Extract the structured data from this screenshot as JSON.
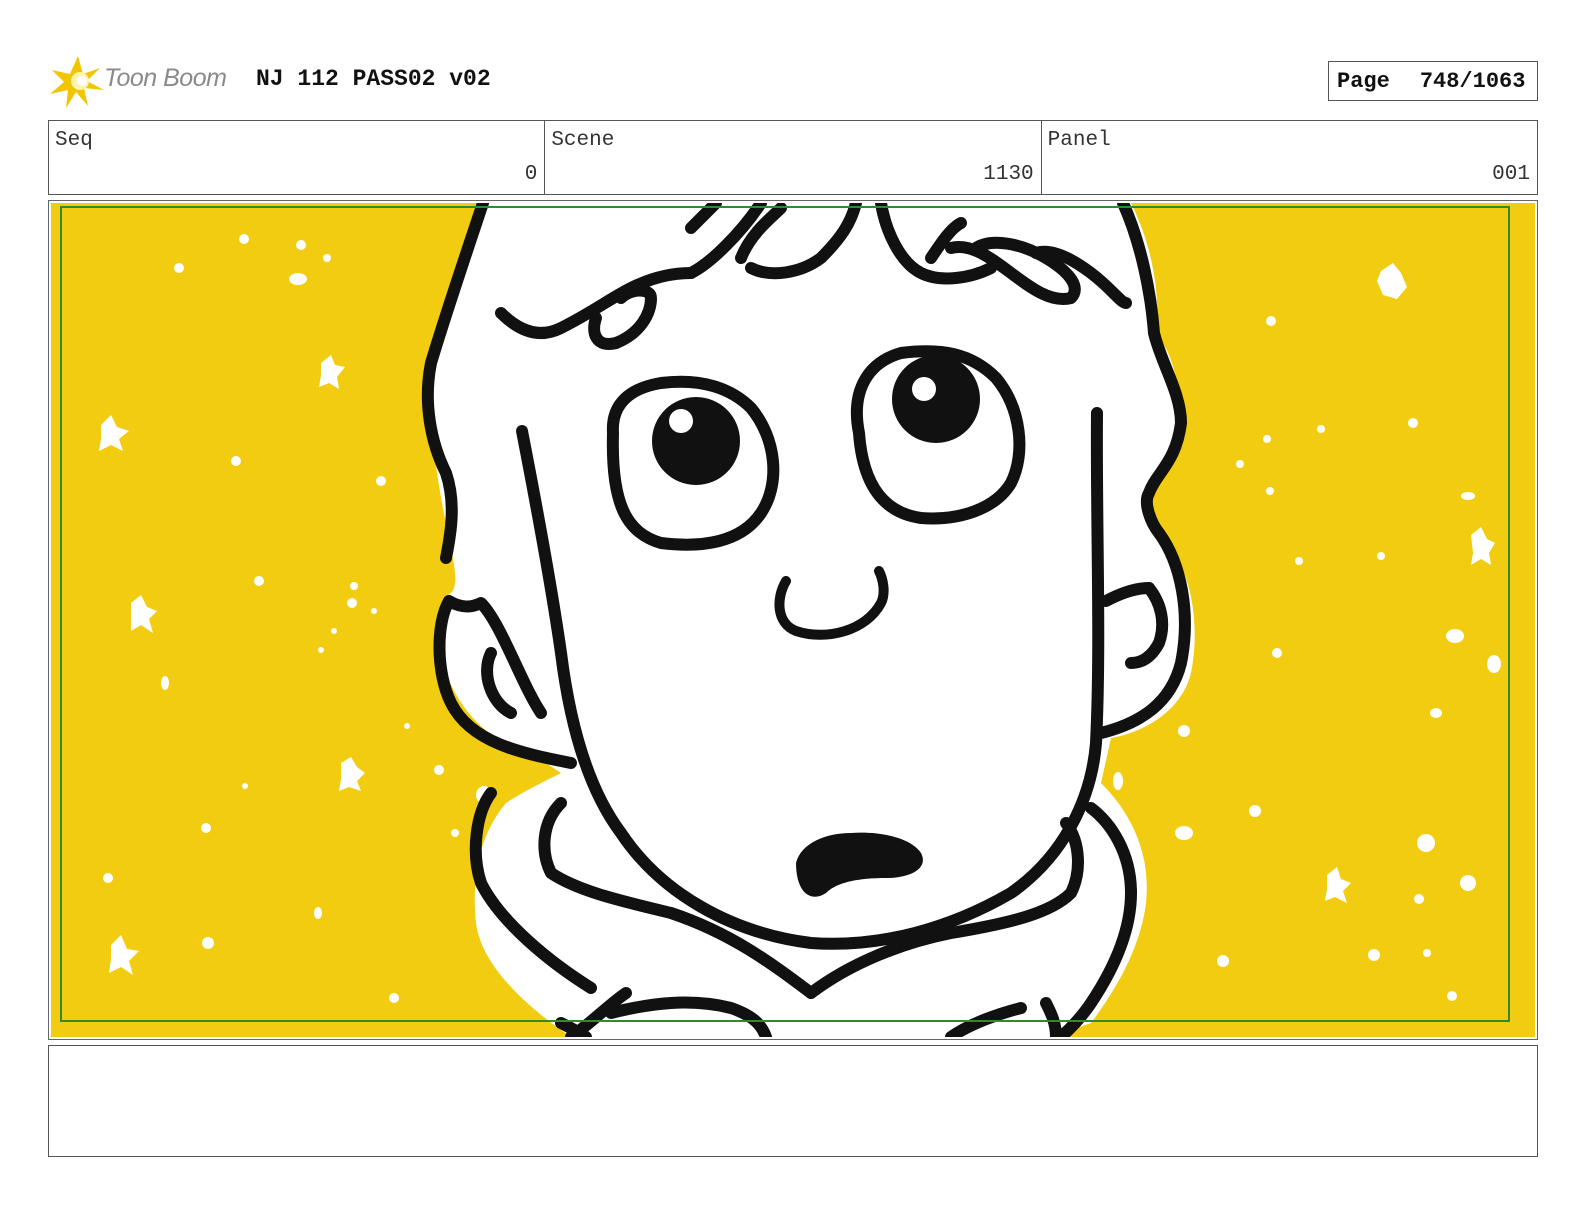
{
  "logo": {
    "brand_text": "Toon Boom",
    "icon": "starburst-logo-icon",
    "accent": "#f2c500"
  },
  "header": {
    "project_title": "NJ 112 PASS02 v02"
  },
  "page": {
    "label": "Page",
    "value": "748/1063"
  },
  "info": {
    "seq_label": "Seq",
    "seq_value": "0",
    "scene_label": "Scene",
    "scene_value": "1130",
    "panel_label": "Panel",
    "panel_value": "001"
  },
  "panel_image": {
    "description_icon": "boy-face-drawing",
    "background_color": "#f2cc10",
    "safe_frame_color": "#2e8b2e"
  },
  "notes": {
    "text": ""
  }
}
